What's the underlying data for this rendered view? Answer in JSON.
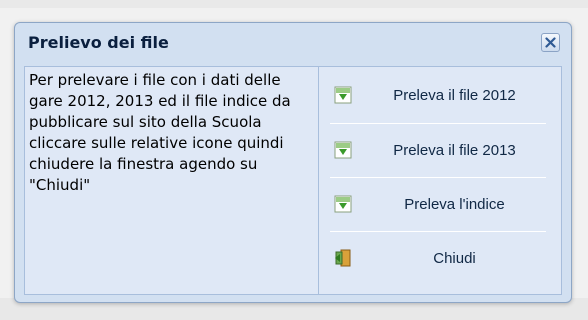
{
  "dialog": {
    "title": "Prelievo dei file",
    "message": "Per prelevare i file con i dati delle gare 2012, 2013 ed il file indice da pubblicare sul sito della Scuola cliccare sulle relative icone quindi chiudere la finestra agendo su \"Chiudi\"",
    "actions": [
      {
        "label": "Preleva il file 2012",
        "icon": "download-icon"
      },
      {
        "label": "Preleva il file 2013",
        "icon": "download-icon"
      },
      {
        "label": "Preleva l'indice",
        "icon": "download-icon"
      },
      {
        "label": "Chiudi",
        "icon": "exit-door-icon"
      }
    ]
  },
  "colors": {
    "accent": "#0a1f3e",
    "panel": "#d2e0f1",
    "download_green": "#3a9a2a"
  }
}
